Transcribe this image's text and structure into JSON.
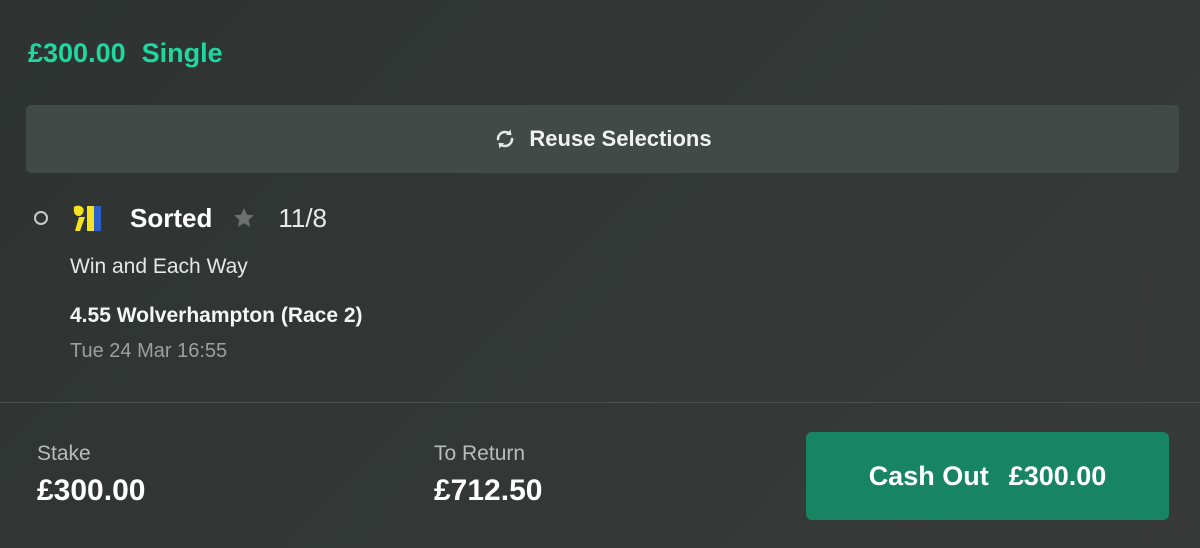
{
  "header": {
    "stake": "£300.00",
    "bet_type": "Single"
  },
  "reuse_button": {
    "label": "Reuse Selections",
    "icon": "refresh-icon"
  },
  "selection": {
    "status_icon": "radio-unchecked-icon",
    "silks_icon": "jockey-silks-icon",
    "horse": "Sorted",
    "favourite_icon": "star-icon",
    "odds": "11/8",
    "market": "Win and Each Way",
    "event": "4.55 Wolverhampton (Race 2)",
    "datetime": "Tue 24 Mar 16:55"
  },
  "footer": {
    "stake_label": "Stake",
    "stake_value": "£300.00",
    "return_label": "To Return",
    "return_value": "£712.50",
    "cashout_label": "Cash Out",
    "cashout_amount": "£300.00"
  },
  "colors": {
    "accent": "#1fd8a0",
    "cashout": "#178561",
    "background": "#313634",
    "button": "#424a47"
  }
}
